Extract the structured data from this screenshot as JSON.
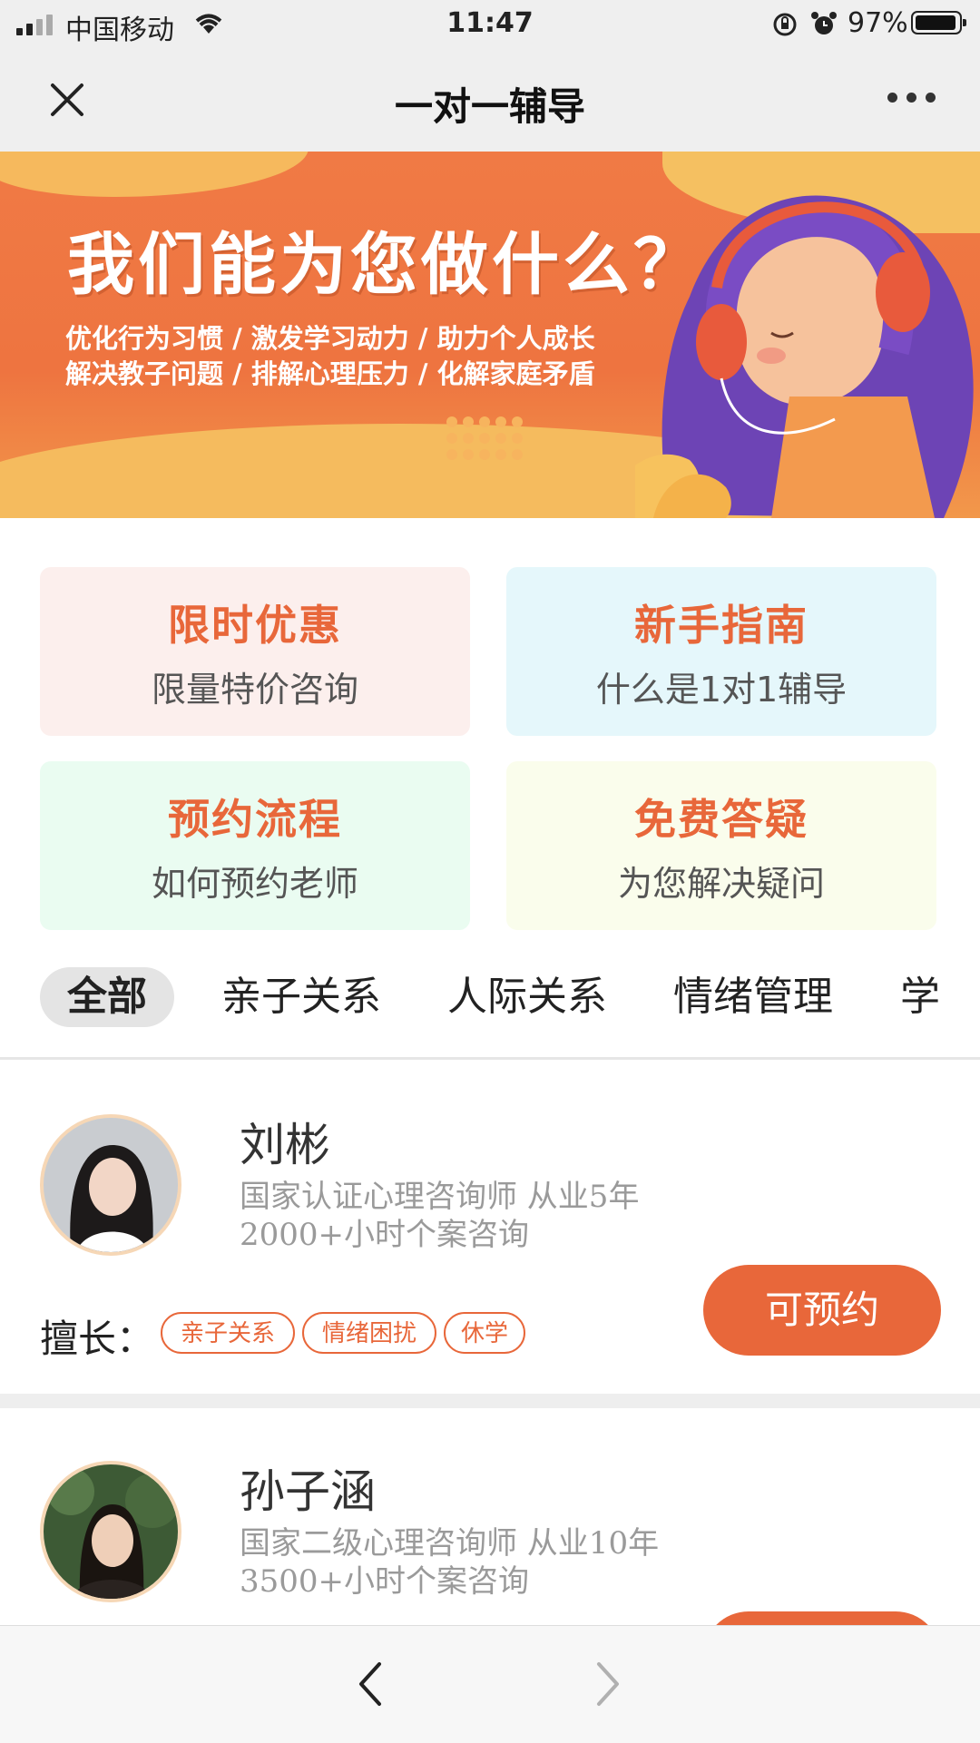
{
  "status_bar": {
    "carrier": "中国移动",
    "time": "11:47",
    "battery": "97%",
    "battery_level": 0.97
  },
  "nav": {
    "title": "一对一辅导",
    "close_icon": "close-icon",
    "more_icon": "more-icon"
  },
  "banner": {
    "headline": "我们能为您做什么？",
    "line1": "优化行为习惯 / 激发学习动力 / 助力个人成长",
    "line2": "解决教子问题 / 排解心理压力 / 化解家庭矛盾"
  },
  "cards": [
    {
      "title": "限时优惠",
      "subtitle": "限量特价咨询",
      "bg": "#fcefed"
    },
    {
      "title": "新手指南",
      "subtitle": "什么是1对1辅导",
      "bg": "#e5f7fb"
    },
    {
      "title": "预约流程",
      "subtitle": "如何预约老师",
      "bg": "#eafcf1"
    },
    {
      "title": "免费答疑",
      "subtitle": "为您解决疑问",
      "bg": "#fafdec"
    }
  ],
  "tabs": [
    "全部",
    "亲子关系",
    "人际关系",
    "情绪管理",
    "学"
  ],
  "specialty_label": "擅长：",
  "counselors": [
    {
      "name": "刘彬",
      "desc1": "国家认证心理咨询师 从业5年",
      "desc2": "2000+小时个案咨询",
      "tags": [
        "亲子关系",
        "情绪困扰",
        "休学"
      ],
      "button": "可预约"
    },
    {
      "name": "孙子涵",
      "desc1": "国家二级心理咨询师 从业10年",
      "desc2": "3500+小时个案咨询"
    }
  ],
  "colors": {
    "accent": "#e8673a",
    "banner": "#ee7440",
    "bar": "#efefef"
  }
}
